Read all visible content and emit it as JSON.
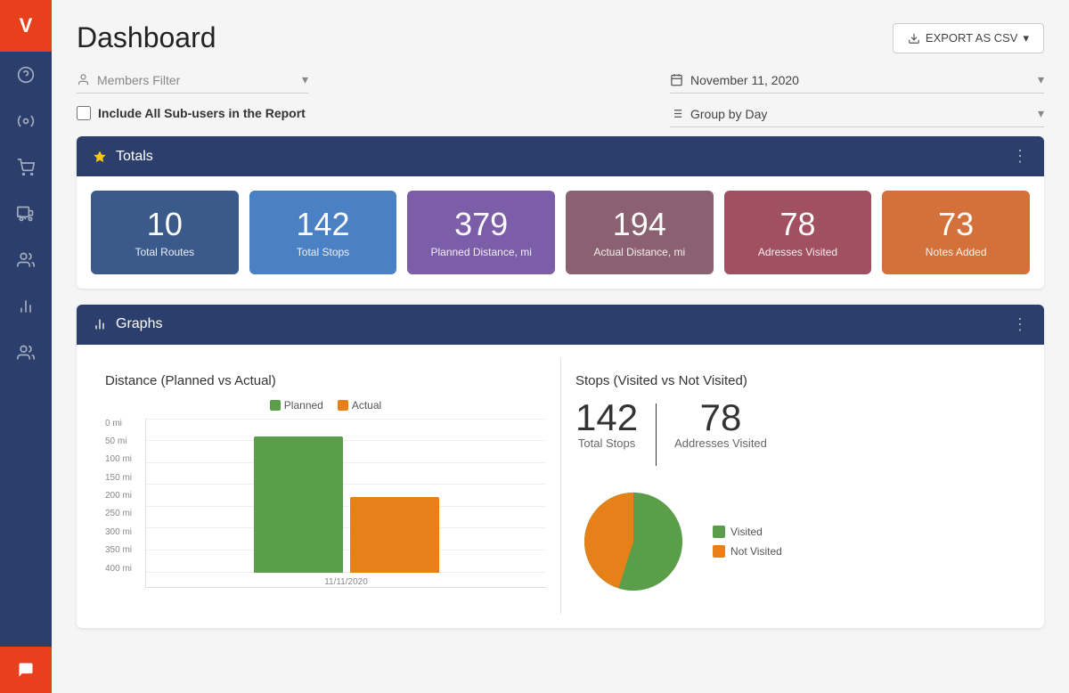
{
  "app": {
    "logo": "V",
    "title": "Dashboard"
  },
  "sidebar": {
    "items": [
      {
        "name": "help",
        "icon": "?"
      },
      {
        "name": "routes",
        "icon": "⟳"
      },
      {
        "name": "orders",
        "icon": "🛒"
      },
      {
        "name": "stops",
        "icon": "📍"
      },
      {
        "name": "drivers",
        "icon": "👤"
      },
      {
        "name": "analytics",
        "icon": "📈"
      },
      {
        "name": "team",
        "icon": "👥"
      }
    ],
    "chat_icon": "💬"
  },
  "header": {
    "title": "Dashboard",
    "export_button": "EXPORT AS CSV"
  },
  "filters": {
    "members_placeholder": "Members Filter",
    "date_value": "November 11, 2020",
    "group_by": "Group by Day",
    "include_subusers": "Include All Sub-users in the Report"
  },
  "totals": {
    "section_title": "Totals",
    "cards": [
      {
        "value": "10",
        "label": "Total Routes",
        "color_class": "card-blue-dark"
      },
      {
        "value": "142",
        "label": "Total Stops",
        "color_class": "card-blue-med"
      },
      {
        "value": "379",
        "label": "Planned Distance, mi",
        "color_class": "card-purple"
      },
      {
        "value": "194",
        "label": "Actual Distance, mi",
        "color_class": "card-mauve"
      },
      {
        "value": "78",
        "label": "Adresses Visited",
        "color_class": "card-rust"
      },
      {
        "value": "73",
        "label": "Notes Added",
        "color_class": "card-orange"
      }
    ]
  },
  "graphs": {
    "section_title": "Graphs",
    "distance_chart": {
      "title": "Distance (Planned vs Actual)",
      "legend": [
        {
          "label": "Planned",
          "color": "green"
        },
        {
          "label": "Actual",
          "color": "orange"
        }
      ],
      "y_labels": [
        "400 mi",
        "350 mi",
        "300 mi",
        "250 mi",
        "200 mi",
        "150 mi",
        "100 mi",
        "50 mi",
        "0 mi"
      ],
      "x_label": "11/11/2020",
      "planned_height_pct": 92,
      "actual_height_pct": 50
    },
    "stops_chart": {
      "title": "Stops (Visited vs Not Visited)",
      "total_stops_value": "142",
      "total_stops_label": "Total Stops",
      "addresses_visited_value": "78",
      "addresses_visited_label": "Addresses Visited",
      "legend": [
        {
          "label": "Visited",
          "color": "#5a9e4a"
        },
        {
          "label": "Not Visited",
          "color": "#e8801a"
        }
      ],
      "pie": {
        "visited_pct": 55,
        "not_visited_pct": 45
      }
    }
  },
  "colors": {
    "sidebar_bg": "#2c3e6b",
    "panel_header_bg": "#2c3e6b",
    "accent_red": "#e8401c",
    "green": "#5a9e4a",
    "orange": "#e8801a"
  }
}
